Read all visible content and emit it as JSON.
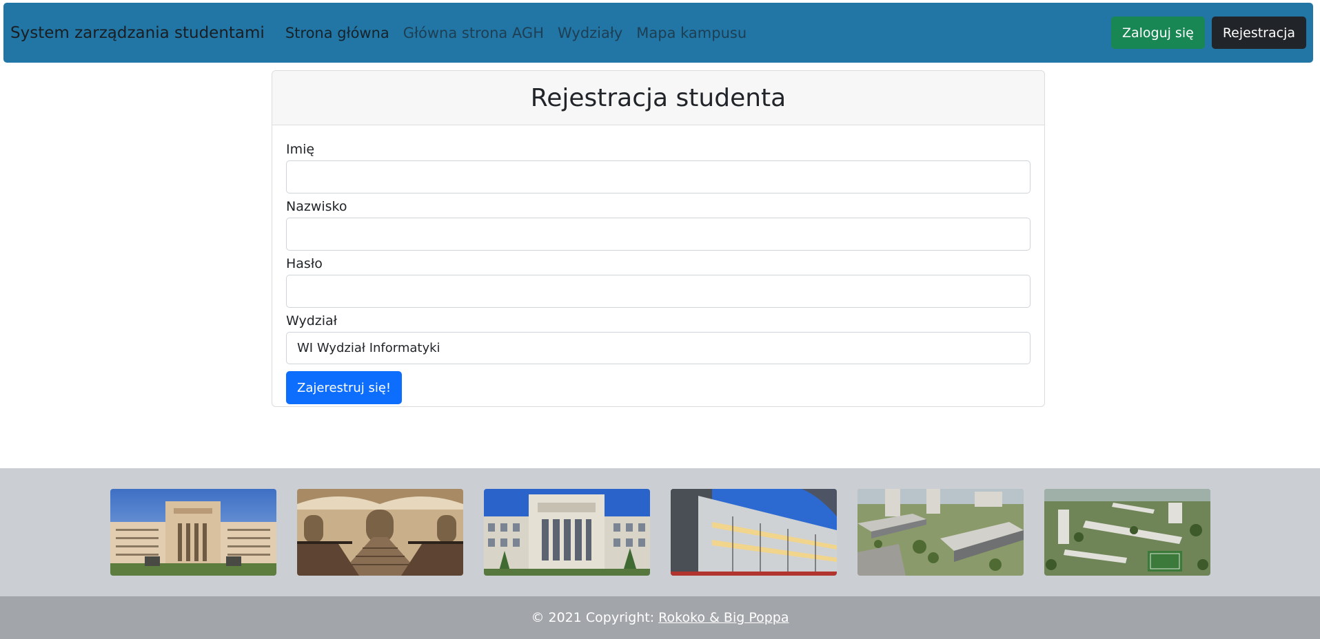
{
  "navbar": {
    "brand": "System zarządzania studentami",
    "links": [
      {
        "label": "Strona główna"
      },
      {
        "label": "Główna strona AGH"
      },
      {
        "label": "Wydziały"
      },
      {
        "label": "Mapa kampusu"
      }
    ],
    "login_label": "Zaloguj się",
    "register_label": "Rejestracja"
  },
  "form": {
    "title": "Rejestracja studenta",
    "first_name_label": "Imię",
    "first_name_value": "",
    "last_name_label": "Nazwisko",
    "last_name_value": "",
    "password_label": "Hasło",
    "password_value": "",
    "faculty_label": "Wydział",
    "faculty_selected": "WI Wydział Informatyki",
    "submit_label": "Zajerestruj się!"
  },
  "gallery": {
    "images": [
      {
        "icon": "agh-main-building-photo"
      },
      {
        "icon": "agh-staircase-photo"
      },
      {
        "icon": "agh-facade-photo"
      },
      {
        "icon": "modern-building-photo"
      },
      {
        "icon": "campus-dormitories-photo"
      },
      {
        "icon": "campus-aerial-photo"
      }
    ]
  },
  "footer": {
    "copyright": "© 2021 Copyright:",
    "authors": "Rokoko & Big Poppa"
  },
  "colors": {
    "navbar_bg": "#2176a5",
    "login_btn": "#198754",
    "register_btn": "#212529",
    "submit_btn": "#0d6efd",
    "gallery_bg": "#cbced2",
    "footer_bg": "#a2a6aa"
  }
}
